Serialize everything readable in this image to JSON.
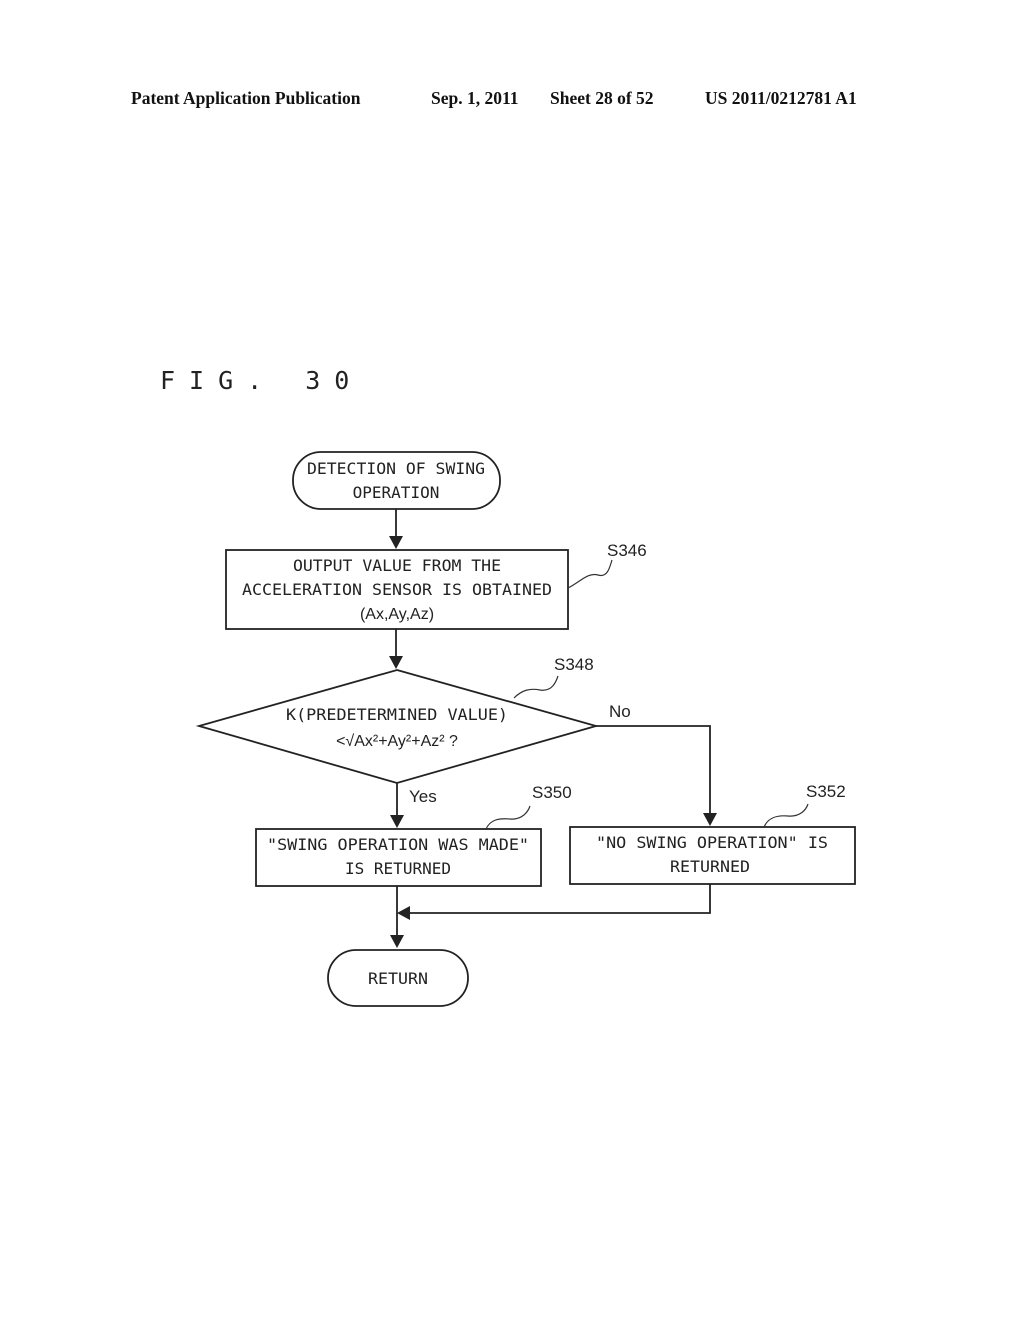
{
  "header": {
    "publication": "Patent Application Publication",
    "date": "Sep. 1, 2011",
    "sheet": "Sheet 28 of 52",
    "number": "US 2011/0212781 A1"
  },
  "figure": {
    "title": "FIG. 30"
  },
  "flowchart": {
    "start": {
      "lines": [
        "DETECTION OF SWING",
        "OPERATION"
      ]
    },
    "s346": {
      "step": "S346",
      "lines": [
        "OUTPUT VALUE FROM THE",
        "ACCELERATION SENSOR IS OBTAINED",
        "(Ax,Ay,Az)"
      ]
    },
    "s348": {
      "step": "S348",
      "lines": [
        "K(PREDETERMINED VALUE)",
        "<√Ax²+Ay²+Az² ?"
      ],
      "yes_label": "Yes",
      "no_label": "No"
    },
    "s350": {
      "step": "S350",
      "lines": [
        "\"SWING OPERATION WAS MADE\"",
        "IS RETURNED"
      ]
    },
    "s352": {
      "step": "S352",
      "lines": [
        "\"NO SWING OPERATION\" IS",
        "RETURNED"
      ]
    },
    "end": {
      "label": "RETURN"
    }
  }
}
